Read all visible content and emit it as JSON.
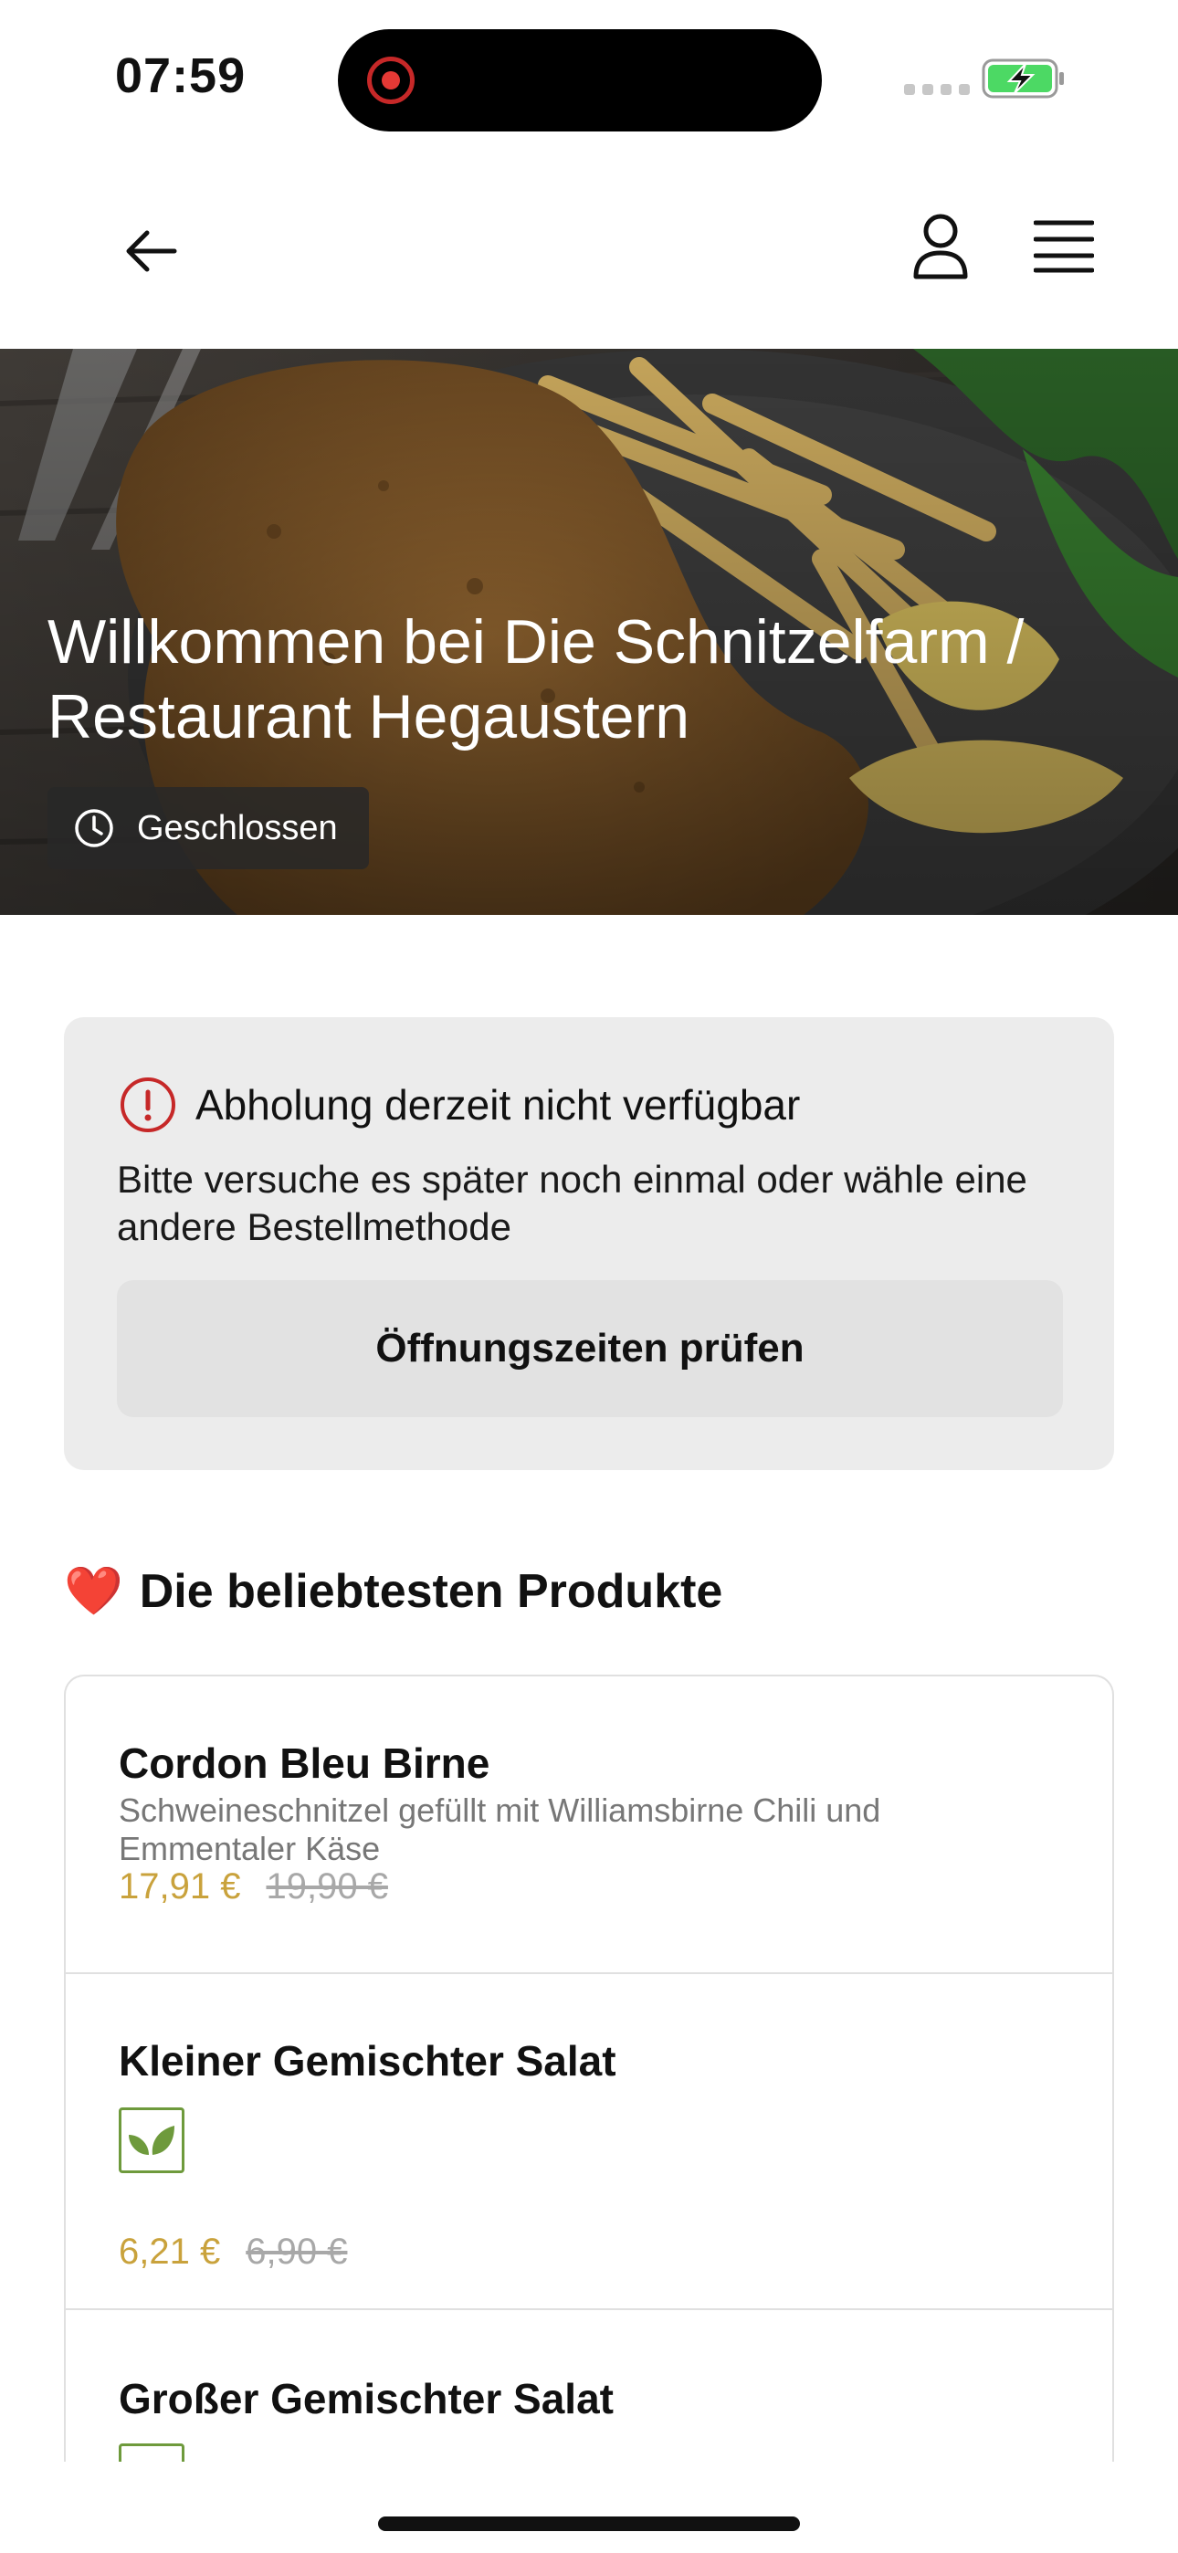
{
  "status_bar": {
    "time": "07:59"
  },
  "header": {
    "back_icon": "arrow-left-icon",
    "account_icon": "user-icon",
    "menu_icon": "hamburger-menu-icon"
  },
  "hero": {
    "title": "Willkommen bei Die Schnitzelfarm / Restaurant Hegaustern",
    "status_badge": "Geschlossen",
    "status_icon": "clock-icon"
  },
  "notice": {
    "icon": "info-icon",
    "title": "Abholung derzeit nicht verfügbar",
    "text": "Bitte versuche es später noch einmal oder wähle eine andere Bestellmethode",
    "button_label": "Öffnungszeiten prüfen"
  },
  "popular": {
    "emoji": "❤️",
    "title": "Die beliebtesten Produkte",
    "items": [
      {
        "name": "Cordon Bleu Birne",
        "description": "Schweineschnitzel gefüllt mit Williamsbirne Chili und Emmentaler Käse",
        "price": "17,91 €",
        "old_price": "19,90 €"
      },
      {
        "name": "Kleiner Gemischter Salat",
        "badge_icon": "leaf-icon",
        "price": "6,21 €",
        "old_price": "6,90 €"
      },
      {
        "name": "Großer Gemischter Salat",
        "badge_icon": "leaf-icon"
      }
    ]
  },
  "colors": {
    "price_accent": "#c9a23c",
    "veg_green": "#6e9a3c",
    "info_red": "#c62828",
    "battery_green": "#4cd964"
  }
}
